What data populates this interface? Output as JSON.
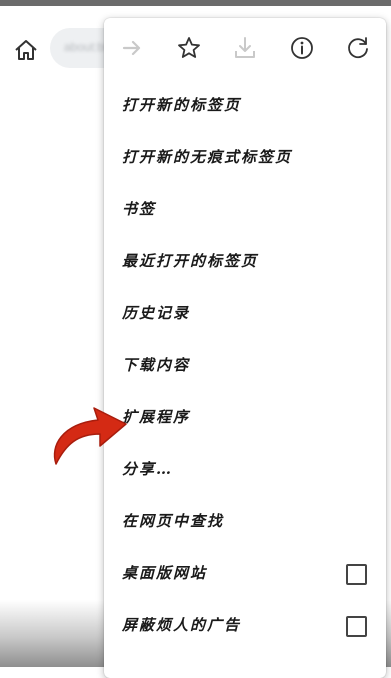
{
  "browser": {
    "address_text": "about:blank",
    "home_icon": "home-icon"
  },
  "menu": {
    "icons": [
      "forward-icon",
      "bookmark-star-icon",
      "download-icon",
      "info-icon",
      "reload-icon"
    ],
    "items": [
      {
        "label": "打开新的标签页"
      },
      {
        "label": "打开新的无痕式标签页"
      },
      {
        "label": "书签"
      },
      {
        "label": "最近打开的标签页"
      },
      {
        "label": "历史记录"
      },
      {
        "label": "下载内容"
      },
      {
        "label": "扩展程序"
      },
      {
        "label": "分享…"
      },
      {
        "label": "在网页中查找"
      },
      {
        "label": "桌面版网站"
      },
      {
        "label": "屏蔽烦人的广告"
      }
    ]
  },
  "colors": {
    "arrow": "#d42a14",
    "menu_bg": "#ffffff",
    "text": "#1a1a1a"
  }
}
